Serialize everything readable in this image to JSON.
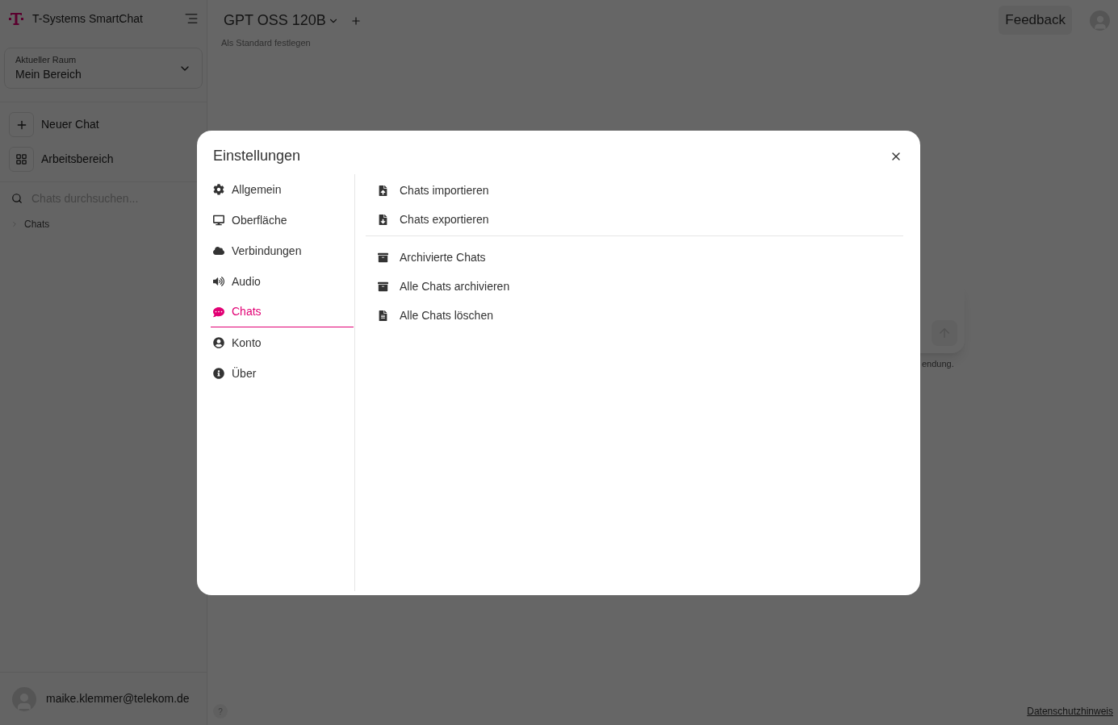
{
  "sidebar": {
    "brand": "T-Systems SmartChat",
    "room": {
      "label": "Aktueller Raum",
      "value": "Mein Bereich"
    },
    "actions": [
      {
        "kind": "new",
        "label": "Neuer Chat"
      },
      {
        "kind": "workspace",
        "label": "Arbeitsbereich"
      }
    ],
    "search": {
      "placeholder": "Chats durchsuchen..."
    },
    "folders": [
      {
        "label": "Chats",
        "expanded": false
      }
    ],
    "user": {
      "email": "maike.klemmer@telekom.de"
    }
  },
  "header": {
    "model": "GPT OSS 120B",
    "set_default": "Als Standard festlegen",
    "feedback": "Feedback"
  },
  "composer": {
    "hint": "endung."
  },
  "help": "?",
  "footer_link": "Datenschutzhinweis",
  "dialog": {
    "title": "Einstellungen",
    "nav": [
      {
        "kind": "general",
        "label": "Allgemein",
        "selected": false
      },
      {
        "kind": "interface",
        "label": "Oberfläche",
        "selected": false
      },
      {
        "kind": "connections",
        "label": "Verbindungen",
        "selected": false
      },
      {
        "kind": "audio",
        "label": "Audio",
        "selected": false
      },
      {
        "kind": "chats",
        "label": "Chats",
        "selected": true
      },
      {
        "kind": "account",
        "label": "Konto",
        "selected": false
      },
      {
        "kind": "about",
        "label": "Über",
        "selected": false
      }
    ],
    "groups": [
      [
        {
          "kind": "import",
          "label": "Chats importieren"
        },
        {
          "kind": "export",
          "label": "Chats exportieren"
        }
      ],
      [
        {
          "kind": "archived",
          "label": "Archivierte Chats"
        },
        {
          "kind": "archive_all",
          "label": "Alle Chats archivieren"
        },
        {
          "kind": "delete_all",
          "label": "Alle Chats löschen"
        }
      ]
    ]
  }
}
